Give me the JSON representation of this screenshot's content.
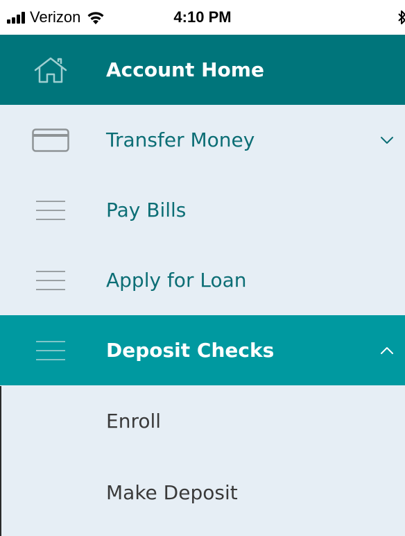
{
  "status_bar": {
    "carrier": "Verizon",
    "time": "4:10 PM",
    "signal_icon": "cellular-signal-icon",
    "wifi_icon": "wifi-icon",
    "bluetooth_icon": "bluetooth-icon"
  },
  "menu": {
    "items": [
      {
        "label": "Account Home",
        "icon": "house-icon"
      },
      {
        "label": "Transfer Money",
        "icon": "credit-card-icon",
        "chevron": "chevron-down-icon"
      },
      {
        "label": "Pay Bills",
        "icon": "menu-lines-icon"
      },
      {
        "label": "Apply for Loan",
        "icon": "menu-lines-icon"
      },
      {
        "label": "Deposit Checks",
        "icon": "menu-lines-icon",
        "chevron": "chevron-up-icon"
      }
    ],
    "submenu": [
      {
        "label": "Enroll"
      },
      {
        "label": "Make Deposit"
      }
    ]
  },
  "colors": {
    "primary_dark": "#00757b",
    "primary_active": "#0099a0",
    "menu_background": "#e6eef5",
    "menu_text": "#0c6e75",
    "submenu_text": "#3a3a3a"
  }
}
